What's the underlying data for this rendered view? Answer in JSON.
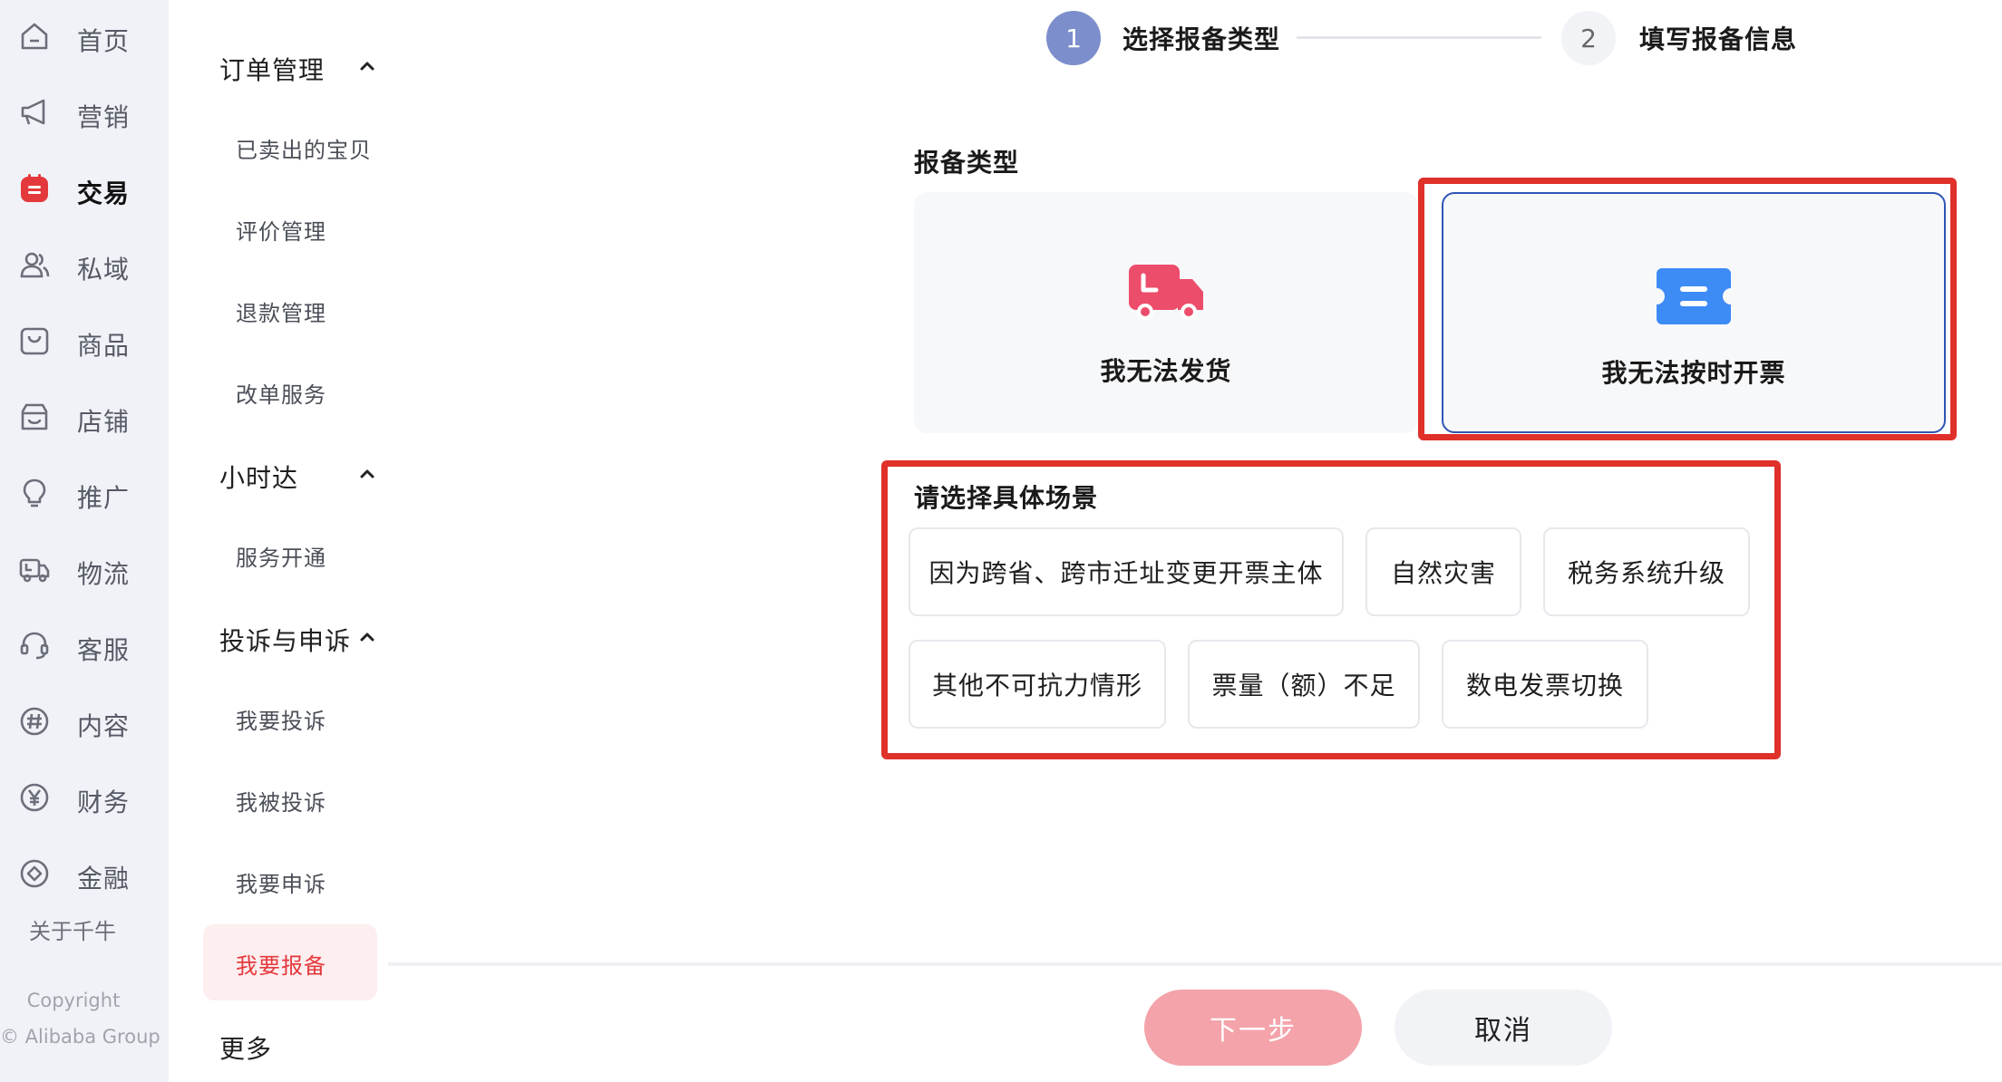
{
  "rail": {
    "items": [
      {
        "label": "首页",
        "icon": "home-icon"
      },
      {
        "label": "营销",
        "icon": "megaphone-icon"
      },
      {
        "label": "交易",
        "icon": "trade-icon"
      },
      {
        "label": "私域",
        "icon": "users-icon"
      },
      {
        "label": "商品",
        "icon": "bag-icon"
      },
      {
        "label": "店铺",
        "icon": "store-icon"
      },
      {
        "label": "推广",
        "icon": "bulb-icon"
      },
      {
        "label": "物流",
        "icon": "truck-icon"
      },
      {
        "label": "客服",
        "icon": "headset-icon"
      },
      {
        "label": "内容",
        "icon": "hash-icon"
      },
      {
        "label": "财务",
        "icon": "yuan-icon"
      },
      {
        "label": "金融",
        "icon": "finance-icon"
      }
    ],
    "active_index": 2,
    "about": "关于千牛",
    "copyright_1": "Copyright",
    "copyright_2": "© Alibaba Group"
  },
  "submenu": {
    "groups": [
      {
        "title": "订单管理",
        "items": [
          "已卖出的宝贝",
          "评价管理",
          "退款管理",
          "改单服务"
        ]
      },
      {
        "title": "小时达",
        "items": [
          "服务开通"
        ]
      },
      {
        "title": "投诉与申诉",
        "items": [
          "我要投诉",
          "我被投诉",
          "我要申诉",
          "我要报备"
        ]
      }
    ],
    "more": "更多",
    "active_item": "我要报备"
  },
  "steps": [
    {
      "number": "1",
      "label": "选择报备类型"
    },
    {
      "number": "2",
      "label": "填写报备信息"
    }
  ],
  "report_type": {
    "title": "报备类型",
    "options": [
      {
        "label": "我无法发货",
        "icon": "truck-icon"
      },
      {
        "label": "我无法按时开票",
        "icon": "ticket-icon"
      }
    ]
  },
  "scenario": {
    "title": "请选择具体场景",
    "options": [
      "因为跨省、跨市迁址变更开票主体",
      "自然灾害",
      "税务系统升级",
      "其他不可抗力情形",
      "票量（额）不足",
      "数电发票切换"
    ]
  },
  "footer": {
    "next_label": "下一步",
    "cancel_label": "取消"
  },
  "colors": {
    "accent_red": "#e0302a",
    "step_active": "#7c8ecb",
    "next_button": "#f4a3aa",
    "truck_icon": "#ec4d6a",
    "ticket_icon": "#3d8bf5"
  }
}
